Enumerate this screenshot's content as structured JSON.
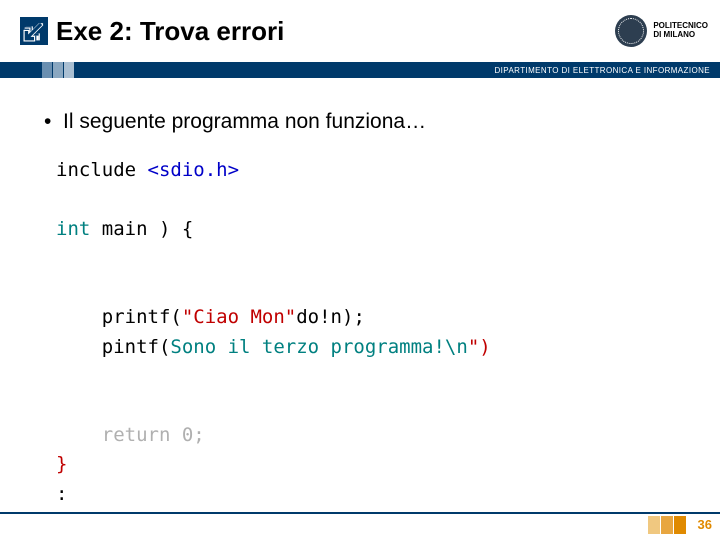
{
  "header": {
    "title": "Exe 2: Trova errori",
    "logo_line1": "POLITECNICO",
    "logo_line2": "DI MILANO",
    "dept": "DIPARTIMENTO DI ELETTRONICA E INFORMAZIONE"
  },
  "bullet": "Il seguente programma non funziona…",
  "code": {
    "l1a": "include ",
    "l1b": "<sdio.h>",
    "l2a": "int",
    "l2b": " main ",
    "l2c": ")",
    "l2d": " {",
    "l3a": "    printf(",
    "l3b": "\"Ciao Mon\"",
    "l3c": "do!n",
    "l3d": ");",
    "l4a": "    pintf(",
    "l4b": "Sono il terzo programma!\\n",
    "l4c": "\")",
    "l5a": "    return ",
    "l5b": "0",
    "l5c": ";",
    "l6": "}",
    "l7": ":"
  },
  "page_number": "36",
  "accent_colors": {
    "blue": "#003a6b",
    "orange": "#e08a00",
    "square1": "#6a8fb0",
    "square2": "#8aa7c0",
    "square3": "#aabfd2",
    "footer_sq1": "#f0b860",
    "footer_sq2": "#e8a640",
    "footer_sq3": "#e08a00"
  }
}
